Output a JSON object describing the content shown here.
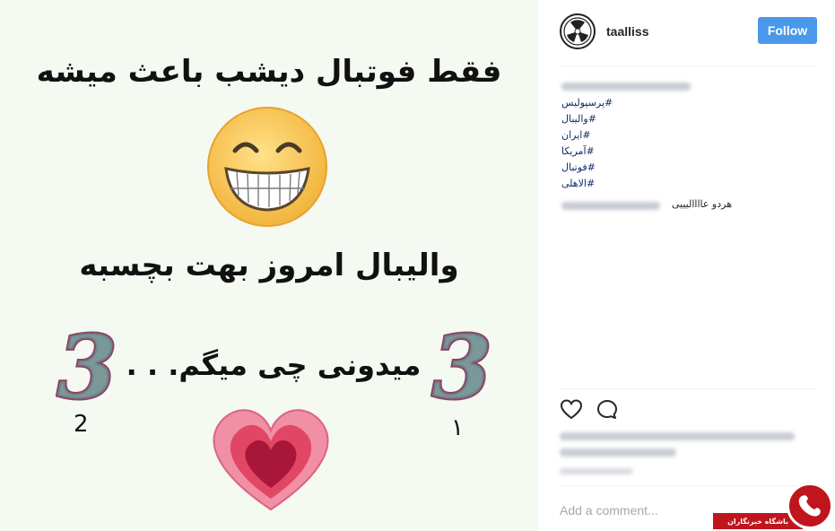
{
  "post_image": {
    "line1": "فقط فوتبال دیشب باعث میشه",
    "line2": "والیبال امروز بهت بچسبه",
    "line3": "میدونی چی میگم. . .",
    "digit_left": "2",
    "digit_right": "١",
    "big_numeral": "3"
  },
  "header": {
    "username": "taalliss",
    "follow_label": "Follow"
  },
  "caption": {
    "hashtags": [
      "#پرسپولیس",
      "#والیبال",
      "#ایران",
      "#آمریکا",
      "#فوتبال",
      "#الاهلی"
    ],
    "text": "هردو عاااالیییی"
  },
  "actions": {
    "like_icon": "heart-outline-icon",
    "comment_icon": "comment-bubble-icon"
  },
  "comment_box": {
    "placeholder": "Add a comment..."
  },
  "watermark": {
    "text": "باشگاه خبرنگاران"
  },
  "colors": {
    "follow_button": "#4a98e9",
    "hashtag": "#0e2e6b",
    "image_background": "#f4f9f1",
    "watermark": "#c0151c"
  }
}
